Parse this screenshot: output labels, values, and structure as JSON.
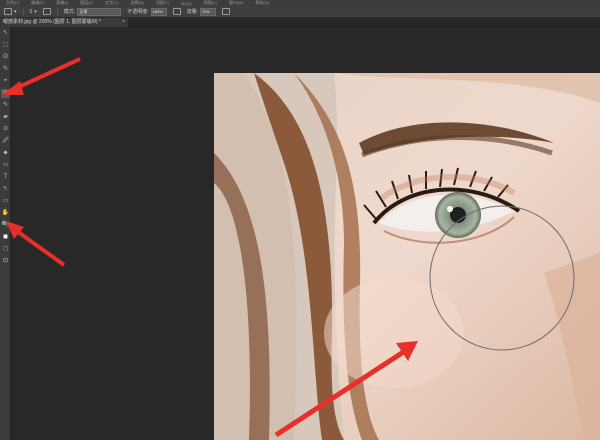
{
  "menubar": {
    "items": [
      "文件(F)",
      "编辑(E)",
      "图像(I)",
      "图层(L)",
      "文字(Y)",
      "选择(S)",
      "滤镜(T)",
      "3D(D)",
      "视图(V)",
      "窗口(W)",
      "帮助(H)"
    ]
  },
  "options": {
    "brush_size": "5",
    "mode_label": "模式:",
    "mode_value": "正常",
    "opacity_label": "不透明度:",
    "opacity_value": "100%",
    "flow_label": "流量:",
    "flow_value": "70%"
  },
  "document": {
    "tab_title": "眼部素材.jpg @ 200% (图层 1, 图层蒙版/8) *",
    "close_glyph": "×"
  },
  "tools": [
    "↖",
    "⬚",
    "ʘ",
    "✎",
    "⌖",
    "◎",
    "✎",
    "▰",
    "⊙",
    "🖉",
    "⬥",
    "▭",
    "T",
    "↖",
    "▭",
    "✋",
    "🔍",
    "◼",
    "◻",
    "⊡"
  ],
  "colors": {
    "annotation_arrow": "#e8302b",
    "background": "#282828",
    "toolbar": "#3b3b3b"
  }
}
